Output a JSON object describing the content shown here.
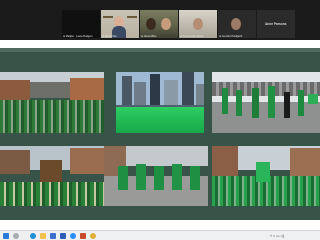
{
  "video_call": {
    "participants": [
      {
        "caption": "⊕ Marijke · Laura Rodgers"
      },
      {
        "caption": "⊕ Nicole Mar"
      },
      {
        "caption": "⊕ Janet Miller"
      },
      {
        "caption": "⊕ Teresa Kelly Monk"
      },
      {
        "caption": "⊕ Jennifer Holdgarth"
      },
      {
        "caption": "Anne Parsons"
      }
    ]
  },
  "slide": {
    "photos": [
      {
        "subject": "parade crowd aerial"
      },
      {
        "subject": "green river with skyscrapers"
      },
      {
        "subject": "marching band in green"
      },
      {
        "subject": "parade float with crowd"
      },
      {
        "subject": "dancers in green dresses"
      },
      {
        "subject": "crowd street green flags"
      }
    ],
    "colors": {
      "background": "#385449",
      "accent": "#1fa84f"
    }
  },
  "taskbar": {
    "icons": [
      "windows-icon",
      "search-icon",
      "edge-icon",
      "folder-icon",
      "store-icon",
      "mail-icon",
      "zoom-icon",
      "powerpoint-icon",
      "chrome-icon"
    ],
    "tray_text": "˄ ⌂ ▭  ◁)"
  }
}
